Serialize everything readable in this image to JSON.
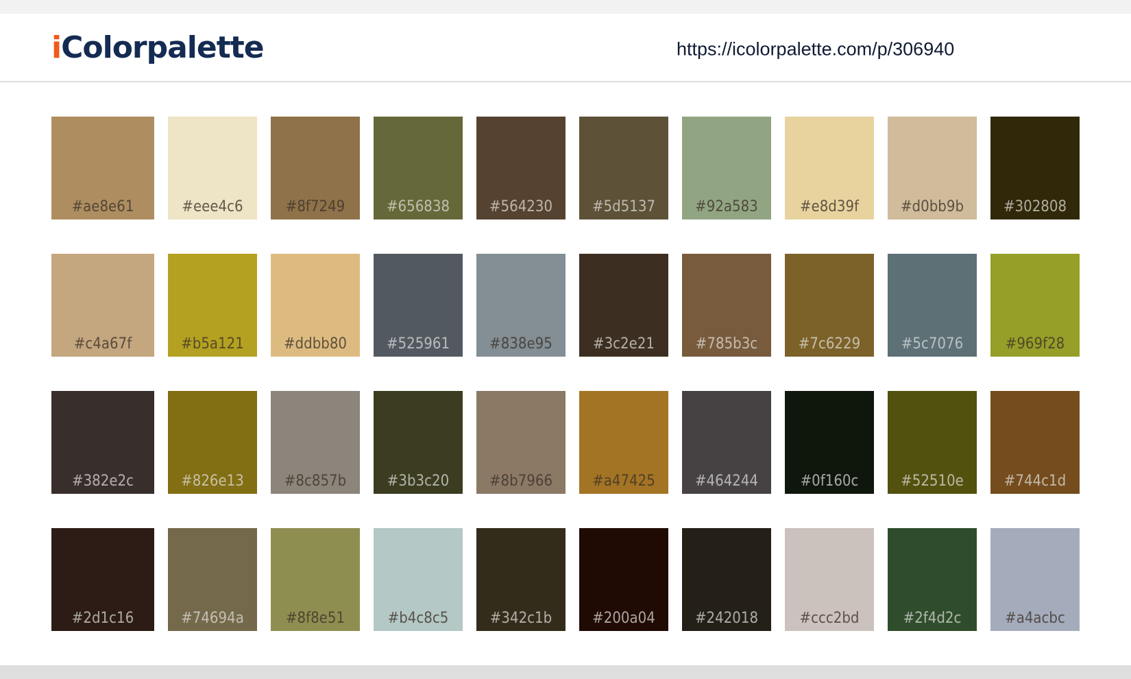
{
  "header": {
    "logo_accent": "i",
    "logo_main": "Colorpalette",
    "url": "https://icolorpalette.com/p/306940"
  },
  "swatches": [
    [
      "#ae8e61",
      "#eee4c6",
      "#8f7249",
      "#656838",
      "#564230",
      "#5d5137",
      "#92a583",
      "#e8d39f",
      "#d0bb9b",
      "#302808"
    ],
    [
      "#c4a67f",
      "#b5a121",
      "#ddbb80",
      "#525961",
      "#838e95",
      "#3c2e21",
      "#785b3c",
      "#7c6229",
      "#5c7076",
      "#969f28"
    ],
    [
      "#382e2c",
      "#826e13",
      "#8c857b",
      "#3b3c20",
      "#8b7966",
      "#a47425",
      "#464244",
      "#0f160c",
      "#52510e",
      "#744c1d"
    ],
    [
      "#2d1c16",
      "#74694a",
      "#8f8e51",
      "#b4c8c5",
      "#342c1b",
      "#200a04",
      "#242018",
      "#ccc2bd",
      "#2f4d2c",
      "#a4acbc"
    ]
  ]
}
